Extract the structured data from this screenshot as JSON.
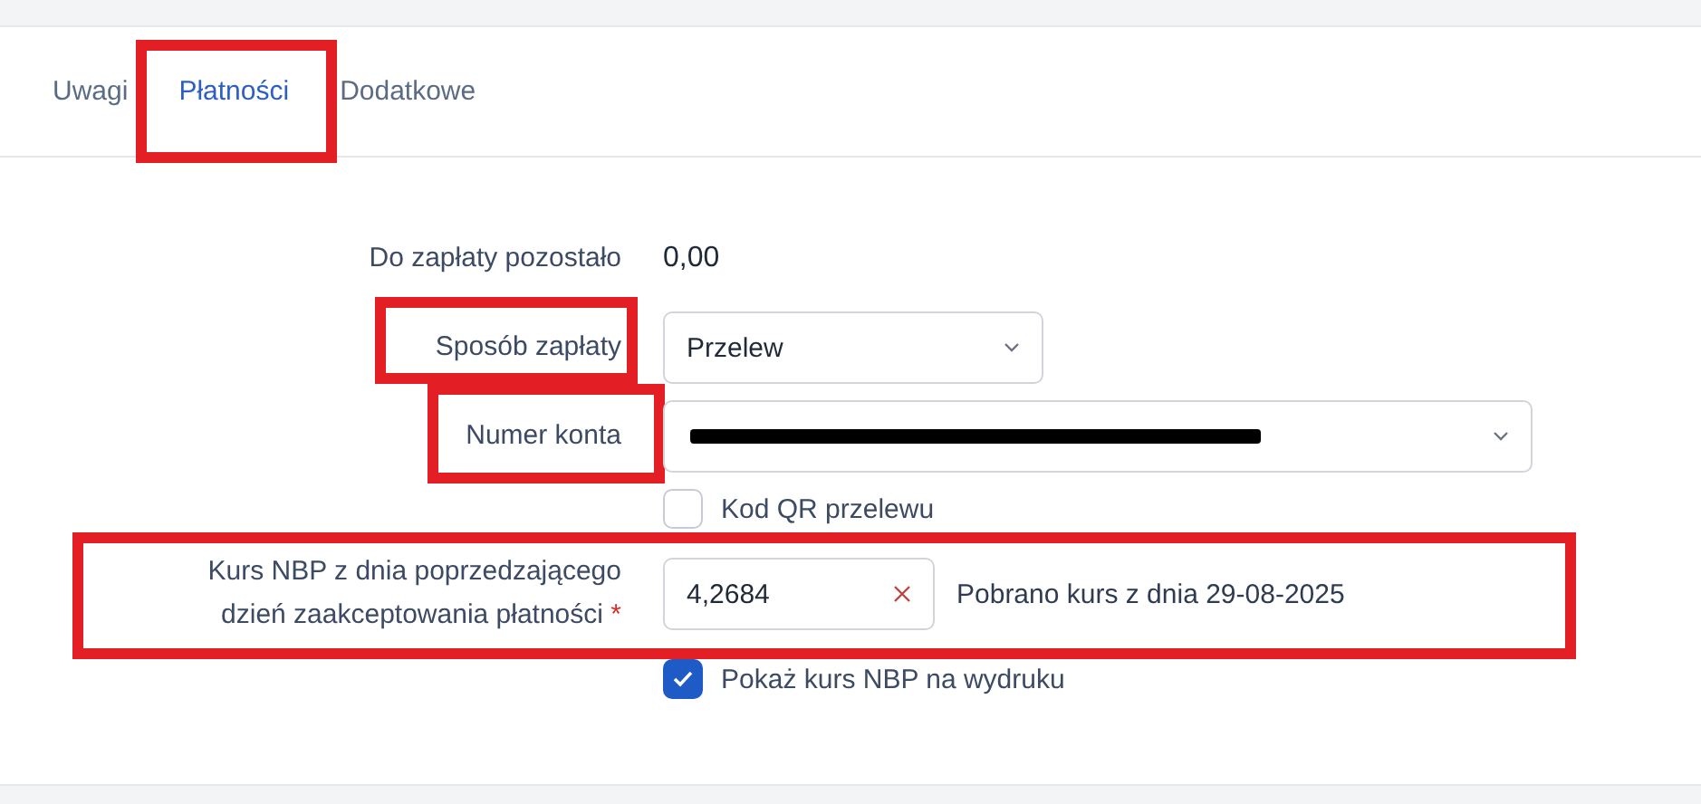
{
  "tabs": [
    {
      "label": "Uwagi",
      "selected": false,
      "highlighted": false
    },
    {
      "label": "Płatności",
      "selected": true,
      "highlighted": true
    },
    {
      "label": "Dodatkowe",
      "selected": false,
      "highlighted": false
    }
  ],
  "form": {
    "remaining": {
      "label": "Do zapłaty pozostało",
      "value": "0,00"
    },
    "payment_method": {
      "label": "Sposób zapłaty",
      "value": "Przelew",
      "highlighted": true
    },
    "account": {
      "label": "Numer konta",
      "redacted": true,
      "highlighted": true
    },
    "qr": {
      "label": "Kod QR przelewu",
      "checked": false
    },
    "rate": {
      "label_lines": [
        "Kurs NBP z dnia poprzedzającego",
        "dzień zaakceptowania płatności"
      ],
      "required_mark": "*",
      "value": "4,2684",
      "note": "Pobrano kurs z dnia 29-08-2025",
      "highlighted": true
    },
    "show_rate": {
      "label": "Pokaż kurs NBP na wydruku",
      "checked": true
    }
  }
}
